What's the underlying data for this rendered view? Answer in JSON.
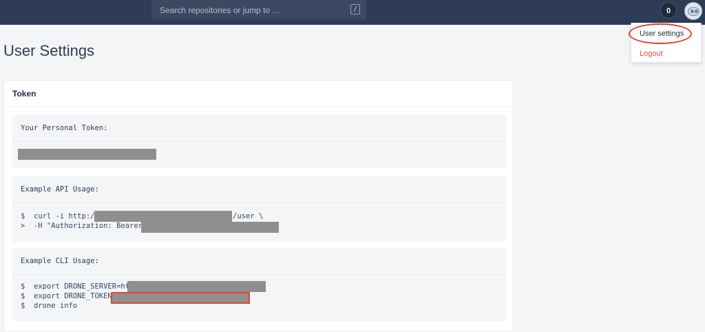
{
  "topbar": {
    "search_placeholder": "Search repositories or jump to …",
    "search_shortcut": "/",
    "notification_count": "0"
  },
  "user_menu": {
    "items": [
      {
        "label": "User settings",
        "highlighted": true
      },
      {
        "label": "Logout"
      }
    ]
  },
  "page": {
    "title": "User Settings"
  },
  "token_card": {
    "title": "Token",
    "personal_token_label": "Your Personal Token:",
    "api_usage_label": "Example API Usage:",
    "api_usage_lines": [
      "$  curl -i http://",
      "/user \\",
      ">  -H \"Authorization: Bearer "
    ],
    "cli_usage_label": "Example CLI Usage:",
    "cli_usage_lines": [
      "$  export DRONE_SERVER=htt",
      "$  export DRONE_TOKEN=",
      "$  drone info"
    ]
  },
  "colors": {
    "topbar": "#2e3c55",
    "accent_red": "#e0442b",
    "logout": "#e14c4c",
    "redaction": "#8f8f8f"
  }
}
